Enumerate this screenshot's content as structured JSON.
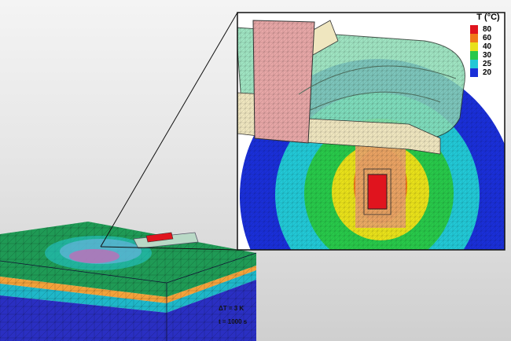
{
  "legend": {
    "title": "T (°C)",
    "entries": [
      {
        "label": "80",
        "color": "#e0141e"
      },
      {
        "label": "60",
        "color": "#f07a18"
      },
      {
        "label": "40",
        "color": "#e8e11a"
      },
      {
        "label": "30",
        "color": "#28c84a"
      },
      {
        "label": "25",
        "color": "#22c8d6"
      },
      {
        "label": "20",
        "color": "#1a2fd8"
      }
    ]
  },
  "annotations": {
    "delta_t": "ΔT = 3 K",
    "time": "t = 1000 s"
  },
  "colors": {
    "mesh_green": "#1f9a55",
    "mesh_cyan": "#1fb7c9",
    "mesh_blue": "#2a2fc2",
    "layer_orange": "#f2a23b",
    "electrode_pink": "#e7a7a7",
    "housing_mint": "#8fe0b8",
    "insulation_beige": "#efe6bf"
  }
}
